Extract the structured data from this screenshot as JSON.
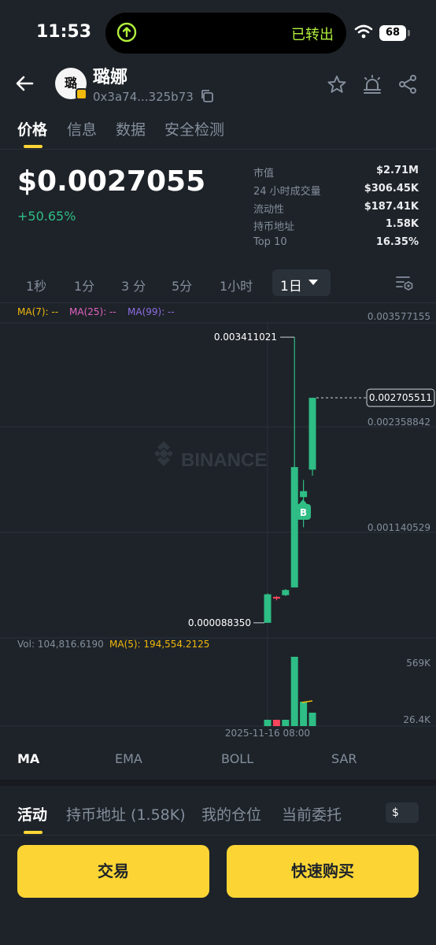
{
  "status": {
    "time": "11:53",
    "island_text": "已转出",
    "battery": "68"
  },
  "header": {
    "avatar_char": "璐",
    "token_name": "璐娜",
    "address": "0x3a74...325b73"
  },
  "tabs": [
    "价格",
    "信息",
    "数据",
    "安全检测"
  ],
  "price": {
    "value": "$0.0027055",
    "change": "+50.65%"
  },
  "stats": [
    {
      "label": "市值",
      "value": "$2.71M"
    },
    {
      "label": "24 小时成交量",
      "value": "$306.45K"
    },
    {
      "label": "流动性",
      "value": "$187.41K"
    },
    {
      "label": "持币地址",
      "value": "1.58K"
    },
    {
      "label": "Top 10",
      "value": "16.35%"
    }
  ],
  "timeframes": [
    "1秒",
    "1分",
    "3 分",
    "5分",
    "1小时"
  ],
  "timeframe_selected": "1日",
  "ma_legend": {
    "ma7": "MA(7): --",
    "ma25": "MA(25): --",
    "ma99": "MA(99): --"
  },
  "watermark": "BINANCE",
  "chart_data": {
    "type": "candlestick",
    "price_axis_labels": [
      "0.003577155",
      "0.002358842",
      "0.001140529"
    ],
    "high_label": "0.003411021",
    "low_label": "0.000088350",
    "current_price_label": "0.002705511",
    "marker": "B",
    "volume_label": "Vol: 104,816.6190",
    "volume_ma_label": "MA(5): 194,554.2125",
    "volume_axis_labels": [
      "569K",
      "26.4K"
    ],
    "time_label": "2025-11-16 08:00",
    "colors": {
      "up": "#2ebd85",
      "down": "#f6465d",
      "ma5": "#f0b90b"
    },
    "candles": [
      {
        "open": 8.835e-05,
        "close": 0.00042,
        "high": 0.00043,
        "low": 8.835e-05
      },
      {
        "open": 0.00039,
        "close": 0.00037,
        "high": 0.0004,
        "low": 0.00035
      },
      {
        "open": 0.00041,
        "close": 0.00047,
        "high": 0.00048,
        "low": 0.0004
      },
      {
        "open": 0.0005,
        "close": 0.0019,
        "high": 0.003411021,
        "low": 0.0005
      },
      {
        "open": 0.00155,
        "close": 0.00162,
        "high": 0.00175,
        "low": 0.0012
      },
      {
        "open": 0.00187,
        "close": 0.002705511,
        "high": 0.002705511,
        "low": 0.0018
      }
    ],
    "volumes": [
      26400,
      26400,
      26400,
      569000,
      200000,
      110000
    ]
  },
  "indicators": [
    "MA",
    "EMA",
    "BOLL",
    "SAR"
  ],
  "activity_tabs": [
    "活动",
    "持币地址 (1.58K)",
    "我的仓位",
    "当前委托"
  ],
  "currency": "$",
  "buttons": {
    "trade": "交易",
    "quick_buy": "快速购买"
  }
}
